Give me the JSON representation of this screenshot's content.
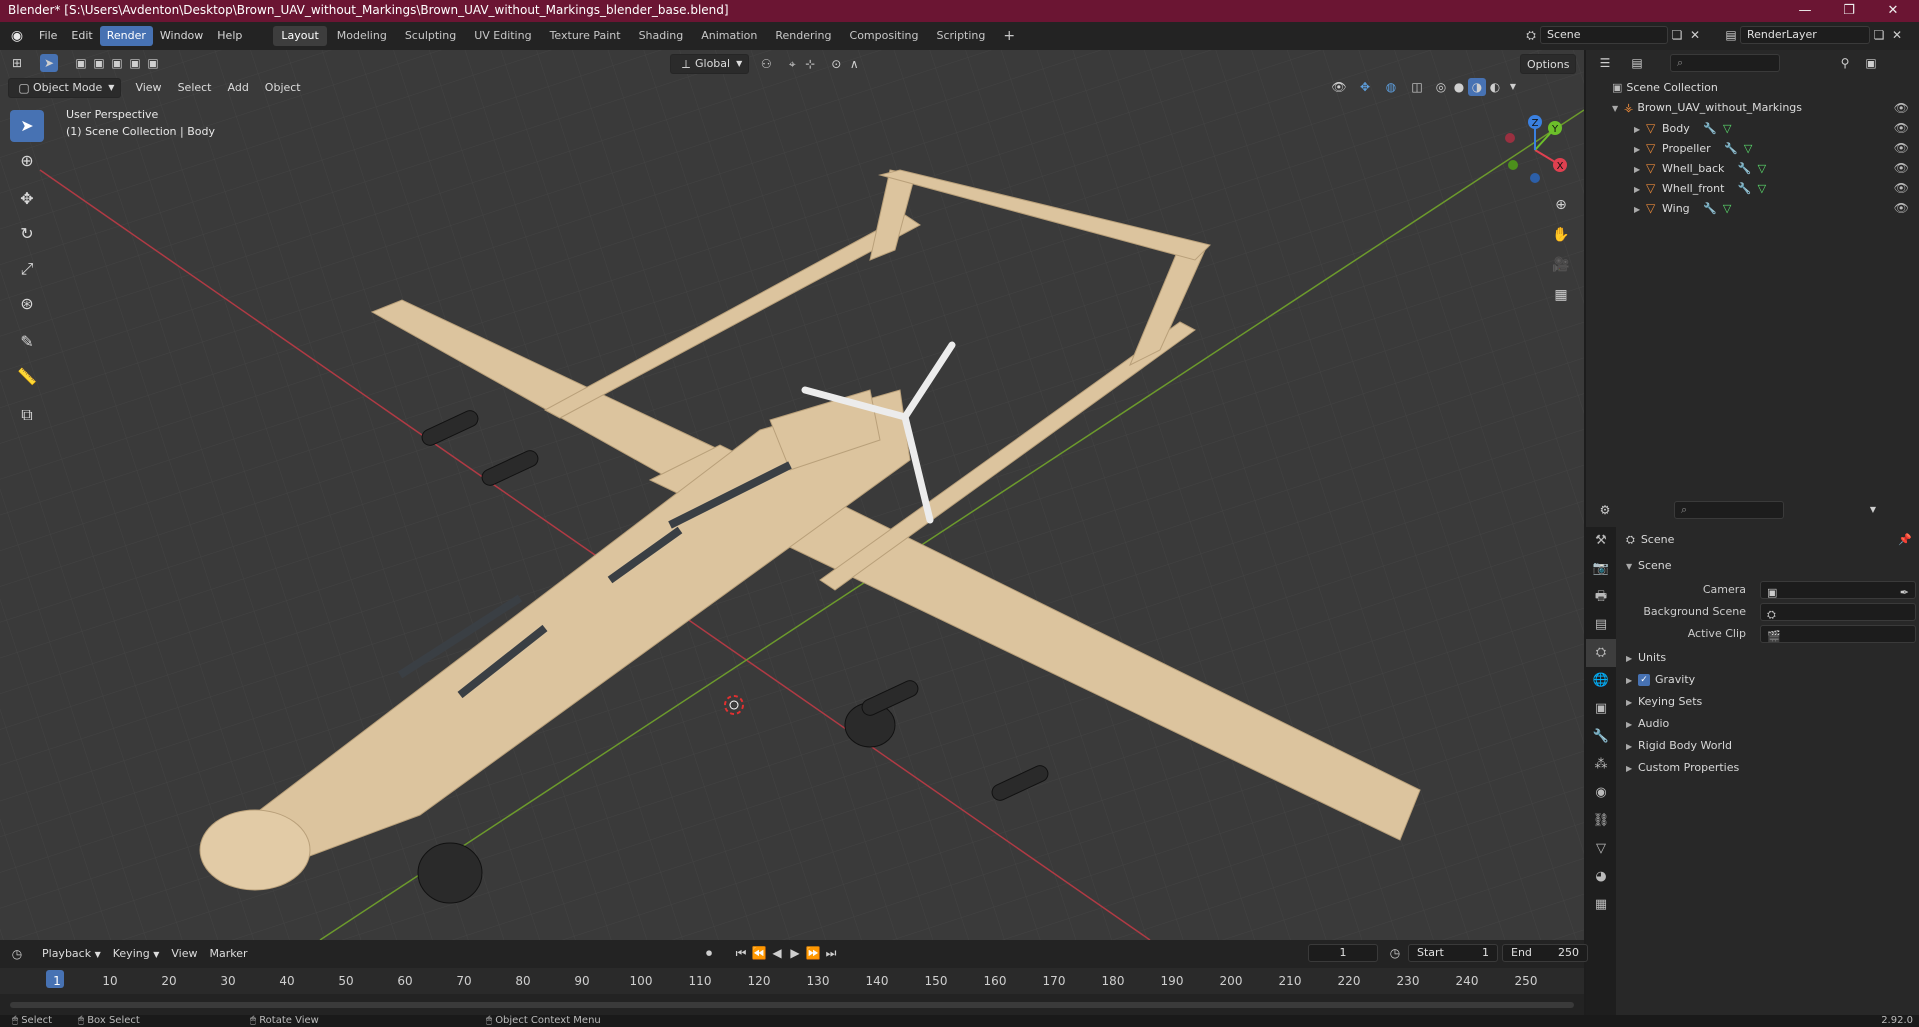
{
  "titlebar": {
    "title": "Blender* [S:\\Users\\Avdenton\\Desktop\\Brown_UAV_without_Markings\\Brown_UAV_without_Markings_blender_base.blend]",
    "minimize": "—",
    "maximize": "❐",
    "close": "✕"
  },
  "menu": {
    "items": [
      "File",
      "Edit",
      "Render",
      "Window",
      "Help"
    ]
  },
  "workspaces": [
    "Layout",
    "Modeling",
    "Sculpting",
    "UV Editing",
    "Texture Paint",
    "Shading",
    "Animation",
    "Rendering",
    "Compositing",
    "Scripting"
  ],
  "scene_field": "Scene",
  "renderlayer_field": "RenderLayer",
  "viewport": {
    "mode": "Object Mode",
    "menus": [
      "View",
      "Select",
      "Add",
      "Object"
    ],
    "transform_orientation": "Global",
    "options_label": "Options",
    "perspective_label": "User Perspective",
    "collection_label": "(1) Scene Collection | Body",
    "gizmo": {
      "x": "X",
      "y": "Y",
      "z": "Z"
    }
  },
  "outliner": {
    "root": "Scene Collection",
    "collection": "Brown_UAV_without_Markings",
    "objects": [
      "Body",
      "Propeller",
      "Whell_back",
      "Whell_front",
      "Wing"
    ]
  },
  "properties": {
    "header": "Scene",
    "panel_scene": "Scene",
    "camera_label": "Camera",
    "background_scene_label": "Background Scene",
    "active_clip_label": "Active Clip",
    "panels": [
      "Units",
      "Gravity",
      "Keying Sets",
      "Audio",
      "Rigid Body World",
      "Custom Properties"
    ]
  },
  "timeline": {
    "menus": [
      "Playback",
      "Keying",
      "View",
      "Marker"
    ],
    "current_frame": "1",
    "start_label": "Start",
    "start_value": "1",
    "end_label": "End",
    "end_value": "250",
    "ticks": [
      "1",
      "10",
      "20",
      "30",
      "40",
      "50",
      "60",
      "70",
      "80",
      "90",
      "100",
      "110",
      "120",
      "130",
      "140",
      "150",
      "160",
      "170",
      "180",
      "190",
      "200",
      "210",
      "220",
      "230",
      "240",
      "250"
    ]
  },
  "statusbar": {
    "select": "Select",
    "box_select": "Box Select",
    "rotate_view": "Rotate View",
    "context_menu": "Object Context Menu",
    "version": "2.92.0"
  },
  "colors": {
    "title_bar": "#6b1533",
    "accent": "#4772b3",
    "drone": "#dcc49e"
  }
}
